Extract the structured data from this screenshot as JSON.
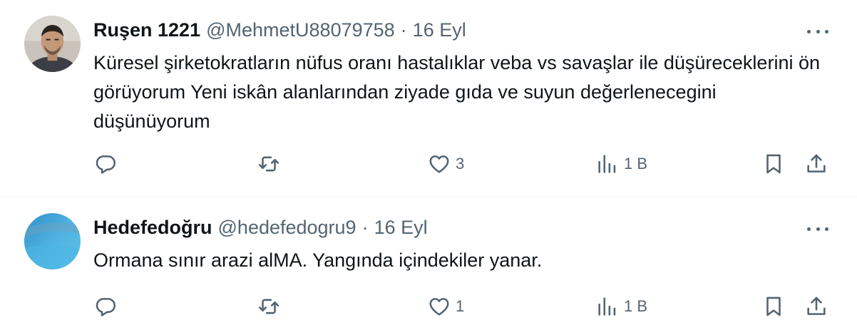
{
  "tweets": [
    {
      "display_name": "Ruşen 1221",
      "handle": "@MehmetU88079758",
      "separator": "·",
      "date": "16 Eyl",
      "text": "Küresel şirketokratların nüfus oranı hastalıklar veba vs savaşlar ile düşüreceklerini ön görüyorum Yeni iskân alanlarından ziyade gıda ve suyun değerlenecegini düşünüyorum",
      "likes": "3",
      "views": "1 B",
      "avatar": "man-portrait"
    },
    {
      "display_name": "Hedefedoğru",
      "handle": "@hedefedogru9",
      "separator": "·",
      "date": "16 Eyl",
      "text": "Ormana sınır arazi alMA. Yangında içindekiler yanar.",
      "likes": "1",
      "views": "1 B",
      "avatar": "blue-abstract"
    }
  ],
  "icons": {
    "reply": "reply-icon",
    "retweet": "retweet-icon",
    "like": "heart-icon",
    "views": "analytics-icon",
    "bookmark": "bookmark-icon",
    "share": "share-icon",
    "more": "more-icon"
  },
  "colors": {
    "text_primary": "#0f1419",
    "text_secondary": "#536471",
    "divider": "#eff3f4"
  }
}
